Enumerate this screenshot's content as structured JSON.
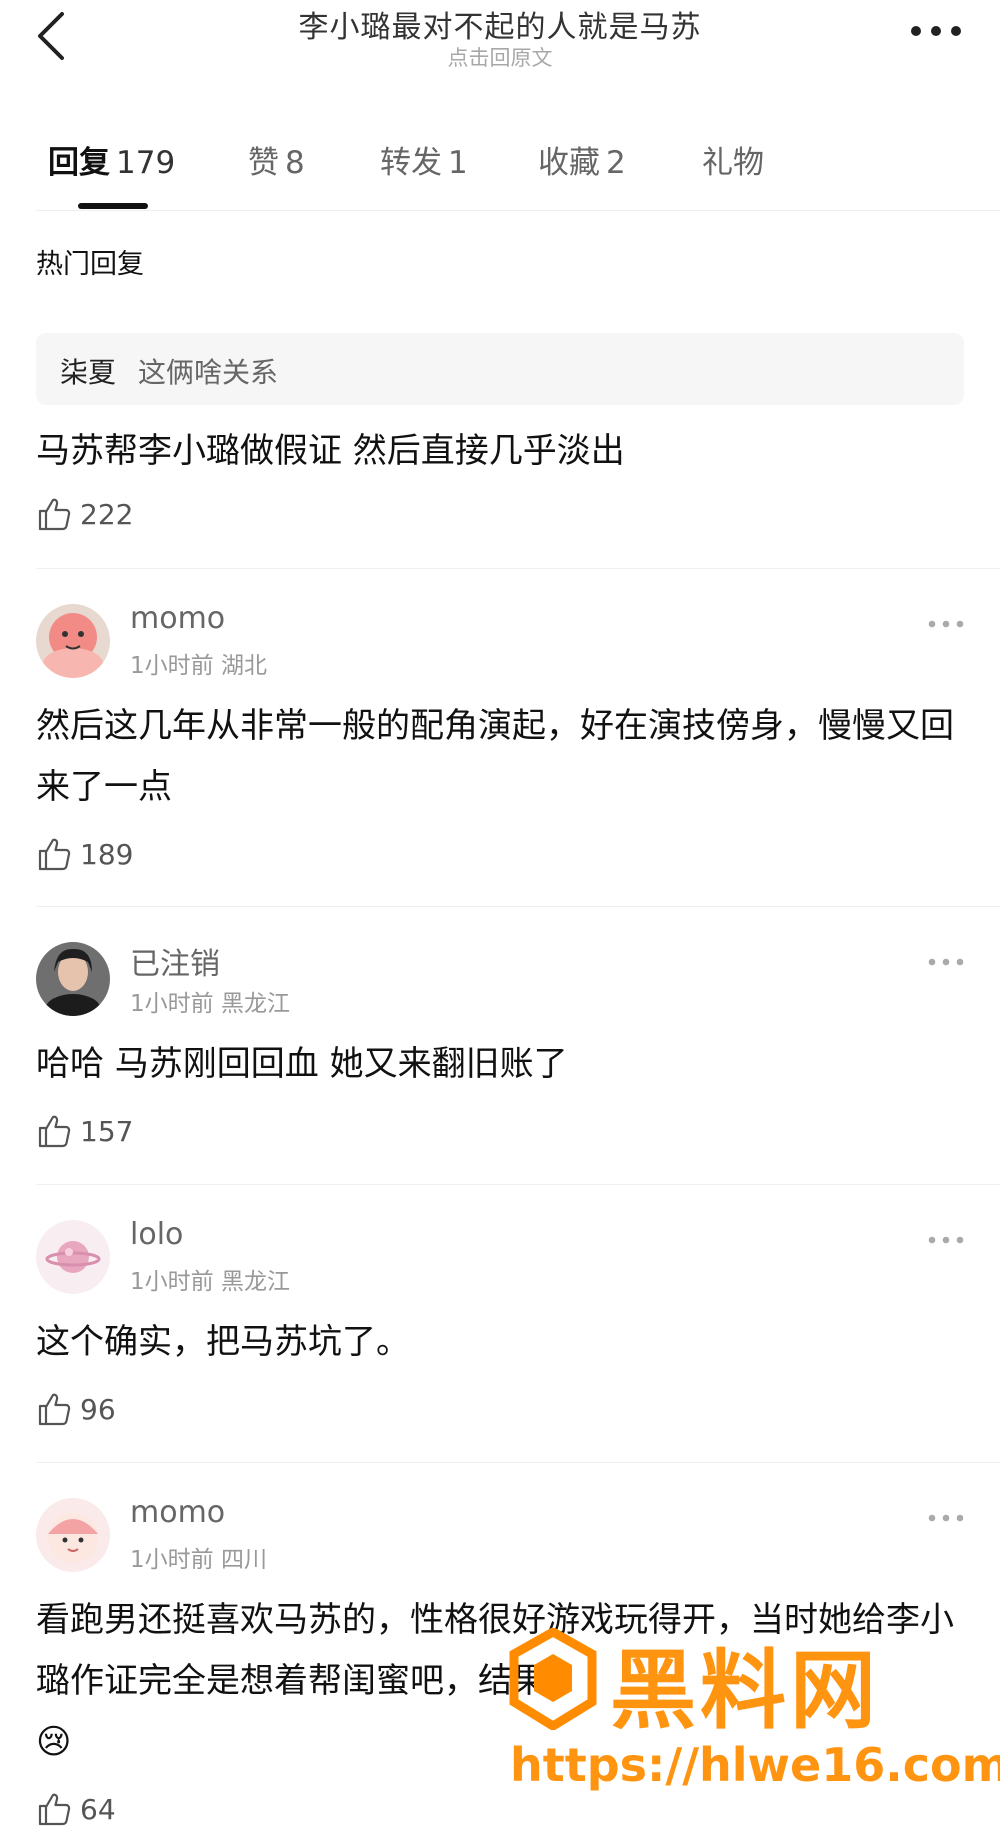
{
  "header": {
    "title": "李小璐最对不起的人就是马苏",
    "subtitle": "点击回原文"
  },
  "tabs": [
    {
      "label": "回复",
      "count": "179",
      "active": true
    },
    {
      "label": "赞",
      "count": "8",
      "active": false
    },
    {
      "label": "转发",
      "count": "1",
      "active": false
    },
    {
      "label": "收藏",
      "count": "2",
      "active": false
    },
    {
      "label": "礼物",
      "count": "",
      "active": false
    }
  ],
  "section_title": "热门回复",
  "hot": {
    "quote_user": "柒夏",
    "quote_text": "这俩啥关系",
    "text": "马苏帮李小璐做假证 然后直接几乎淡出",
    "likes": "222"
  },
  "comments": [
    {
      "username": "momo",
      "time": "1小时前",
      "location": "湖北",
      "text": "然后这几年从非常一般的配角演起，好在演技傍身，慢慢又回来了一点",
      "likes": "189"
    },
    {
      "username": "已注销",
      "time": "1小时前",
      "location": "黑龙江",
      "text": "哈哈 马苏刚回回血  她又来翻旧账了",
      "likes": "157"
    },
    {
      "username": "lolo",
      "time": "1小时前",
      "location": "黑龙江",
      "text": "这个确实，把马苏坑了。",
      "likes": "96"
    },
    {
      "username": "momo",
      "time": "1小时前",
      "location": "四川",
      "text": "看跑男还挺喜欢马苏的，性格很好游戏玩得开，当时她给李小璐作证完全是想着帮闺蜜吧，结果",
      "emoji": "😢",
      "likes": "64"
    }
  ],
  "watermark": {
    "text": "黑料网",
    "url": "https://hlwe16.com"
  },
  "colors": {
    "watermark": "#ff8c00",
    "text_primary": "#111111",
    "text_secondary": "#999999"
  }
}
